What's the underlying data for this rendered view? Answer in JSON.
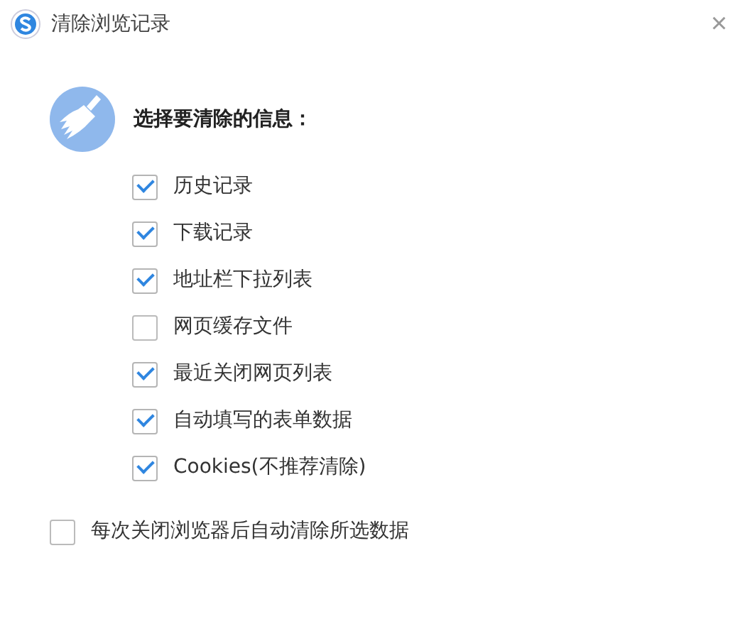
{
  "window": {
    "title": "清除浏览记录",
    "close": "×"
  },
  "heading": "选择要清除的信息：",
  "options": [
    {
      "label": "历史记录",
      "checked": true
    },
    {
      "label": "下载记录",
      "checked": true
    },
    {
      "label": "地址栏下拉列表",
      "checked": true
    },
    {
      "label": "网页缓存文件",
      "checked": false
    },
    {
      "label": "最近关闭网页列表",
      "checked": true
    },
    {
      "label": "自动填写的表单数据",
      "checked": true
    },
    {
      "label": "Cookies(不推荐清除)",
      "checked": true
    }
  ],
  "auto_clear": {
    "label": "每次关闭浏览器后自动清除所选数据",
    "checked": false
  }
}
